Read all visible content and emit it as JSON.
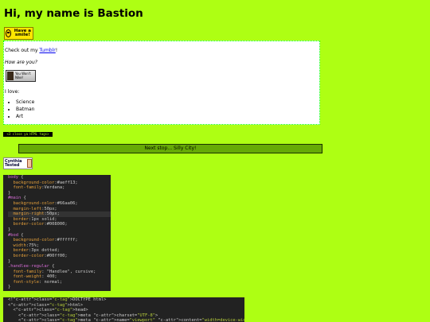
{
  "page": {
    "title": "Hi, my name is Bastion",
    "smile_badge": "Have a smile!"
  },
  "bod": {
    "tumblr_prefix": "Check out my ",
    "tumblr_link": "Tumblr",
    "tumblr_suffix": "!",
    "how_are_you": "How are you?",
    "nike_badge": "You Won't Nike!",
    "love_intro": "I love:",
    "loves": [
      "Science",
      "Batman",
      "Art"
    ]
  },
  "html_tags_badge": "<3 close ya HTML tags>",
  "next_stop": "Next stop... Silly City!",
  "cynthia_badge": "Cynthia Tested",
  "css_code": {
    "lines": [
      "body {",
      "  background-color:#aeff13;",
      "  font-family:Verdana;",
      "}",
      "#main {",
      "  background-color:#66aa06;",
      "  margin-left:50px;",
      "  margin-right:50px;",
      "  border:1px solid;",
      "  border-color:#008000;",
      "}",
      "#bod {",
      "  background-color:#ffffff;",
      "  width:75%;",
      "  border:3px dotted;",
      "  border-color:#00ff00;",
      "}",
      ".handlee-regular {",
      "  font-family: \"Handlee\", cursive;",
      "  font-weight: 400;",
      "  font-style: normal;",
      "}"
    ],
    "highlight_line": 7
  },
  "html_code": {
    "lines": [
      "<!DOCTYPE html>",
      "<html>",
      "  <head>",
      "    <meta charset=\"UTF-8\">",
      "    <meta name=\"viewport\" content=\"width=device-width, initial-scale=1.0\">"
    ]
  },
  "colors": {
    "page_bg": "#aeff13",
    "main_bg": "#66aa06",
    "bod_bg": "#ffffff",
    "bod_border": "#00ff00",
    "code_bg": "#222222"
  }
}
